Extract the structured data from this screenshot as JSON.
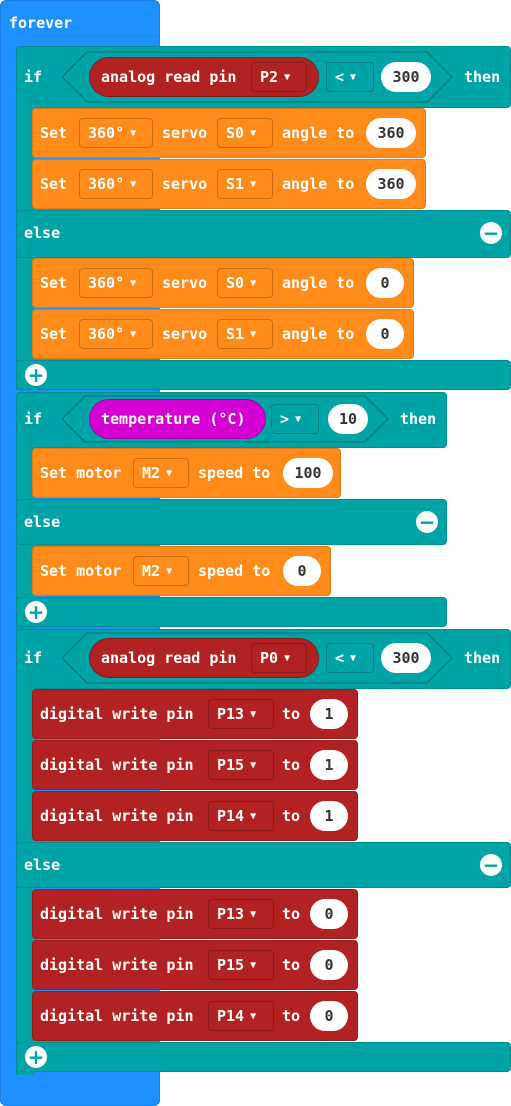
{
  "forever_label": "forever",
  "if1": {
    "if_label": "if",
    "cond_block": "analog read pin",
    "pin": "P2",
    "op": "<",
    "value": "300",
    "then_label": "then",
    "then_rows": [
      {
        "set": "Set",
        "type": "360°",
        "servo": "servo",
        "channel": "S0",
        "angle_to": "angle to",
        "value": "360"
      },
      {
        "set": "Set",
        "type": "360°",
        "servo": "servo",
        "channel": "S1",
        "angle_to": "angle to",
        "value": "360"
      }
    ],
    "else_label": "else",
    "else_rows": [
      {
        "set": "Set",
        "type": "360°",
        "servo": "servo",
        "channel": "S0",
        "angle_to": "angle to",
        "value": "0"
      },
      {
        "set": "Set",
        "type": "360°",
        "servo": "servo",
        "channel": "S1",
        "angle_to": "angle to",
        "value": "0"
      }
    ]
  },
  "if2": {
    "if_label": "if",
    "cond_block": "temperature (°C)",
    "op": ">",
    "value": "10",
    "then_label": "then",
    "then_row": {
      "set_motor": "Set motor",
      "motor": "M2",
      "speed_to": "speed to",
      "value": "100"
    },
    "else_label": "else",
    "else_row": {
      "set_motor": "Set motor",
      "motor": "M2",
      "speed_to": "speed to",
      "value": "0"
    }
  },
  "if3": {
    "if_label": "if",
    "cond_block": "analog read pin",
    "pin": "P0",
    "op": "<",
    "value": "300",
    "then_label": "then",
    "then_rows": [
      {
        "label": "digital write pin",
        "pin": "P13",
        "to": "to",
        "value": "1"
      },
      {
        "label": "digital write pin",
        "pin": "P15",
        "to": "to",
        "value": "1"
      },
      {
        "label": "digital write pin",
        "pin": "P14",
        "to": "to",
        "value": "1"
      }
    ],
    "else_label": "else",
    "else_rows": [
      {
        "label": "digital write pin",
        "pin": "P13",
        "to": "to",
        "value": "0"
      },
      {
        "label": "digital write pin",
        "pin": "P15",
        "to": "to",
        "value": "0"
      },
      {
        "label": "digital write pin",
        "pin": "P14",
        "to": "to",
        "value": "0"
      }
    ]
  },
  "icons": {
    "add": "plus-circle-icon",
    "remove": "minus-circle-icon",
    "caret": "caret-down-icon"
  },
  "colors": {
    "forever": "#1e90ff",
    "logic": "#00a4a6",
    "servo": "#ff8c1a",
    "pins": "#b22222",
    "temperature": "#d400d4"
  }
}
